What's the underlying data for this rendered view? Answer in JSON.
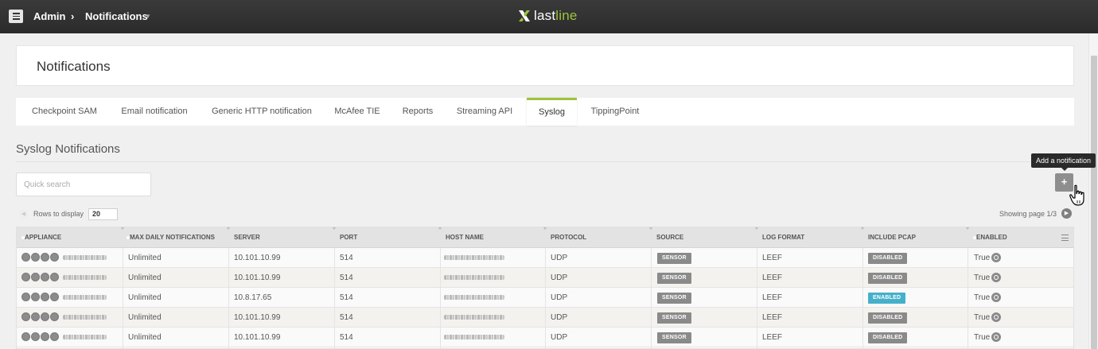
{
  "header": {
    "breadcrumb": [
      "Admin",
      "Notifications"
    ],
    "separator": "›",
    "brand": {
      "main": "last",
      "accent": "line"
    }
  },
  "page": {
    "title": "Notifications"
  },
  "tabs": [
    {
      "label": "Checkpoint SAM",
      "active": false
    },
    {
      "label": "Email notification",
      "active": false
    },
    {
      "label": "Generic HTTP notification",
      "active": false
    },
    {
      "label": "McAfee TIE",
      "active": false
    },
    {
      "label": "Reports",
      "active": false
    },
    {
      "label": "Streaming API",
      "active": false
    },
    {
      "label": "Syslog",
      "active": true
    },
    {
      "label": "TippingPoint",
      "active": false
    }
  ],
  "section": {
    "title": "Syslog Notifications"
  },
  "search": {
    "placeholder": "Quick search"
  },
  "tooltip": "Add a notification",
  "add_button": "+",
  "pager": {
    "rows_label": "Rows to display",
    "rows_value": "20",
    "showing": "Showing page 1/3"
  },
  "table": {
    "columns": [
      "APPLIANCE",
      "MAX DAILY NOTIFICATIONS",
      "SERVER",
      "PORT",
      "HOST NAME",
      "PROTOCOL",
      "SOURCE",
      "LOG FORMAT",
      "INCLUDE PCAP",
      "ENABLED"
    ],
    "rows": [
      {
        "max": "Unlimited",
        "server": "10.101.10.99",
        "port": "514",
        "protocol": "UDP",
        "source": "SENSOR",
        "log_format": "LEEF",
        "pcap": "DISABLED",
        "enabled": "True"
      },
      {
        "max": "Unlimited",
        "server": "10.101.10.99",
        "port": "514",
        "protocol": "UDP",
        "source": "SENSOR",
        "log_format": "LEEF",
        "pcap": "DISABLED",
        "enabled": "True"
      },
      {
        "max": "Unlimited",
        "server": "10.8.17.65",
        "port": "514",
        "protocol": "UDP",
        "source": "SENSOR",
        "log_format": "LEEF",
        "pcap": "ENABLED",
        "enabled": "True"
      },
      {
        "max": "Unlimited",
        "server": "10.101.10.99",
        "port": "514",
        "protocol": "UDP",
        "source": "SENSOR",
        "log_format": "LEEF",
        "pcap": "DISABLED",
        "enabled": "True"
      },
      {
        "max": "Unlimited",
        "server": "10.101.10.99",
        "port": "514",
        "protocol": "UDP",
        "source": "SENSOR",
        "log_format": "LEEF",
        "pcap": "DISABLED",
        "enabled": "True"
      }
    ]
  },
  "colors": {
    "accent": "#9cc43c",
    "enabled_badge": "#45b0c9",
    "badge_gray": "#8a8a8a",
    "topbar": "#2f2f2f"
  }
}
